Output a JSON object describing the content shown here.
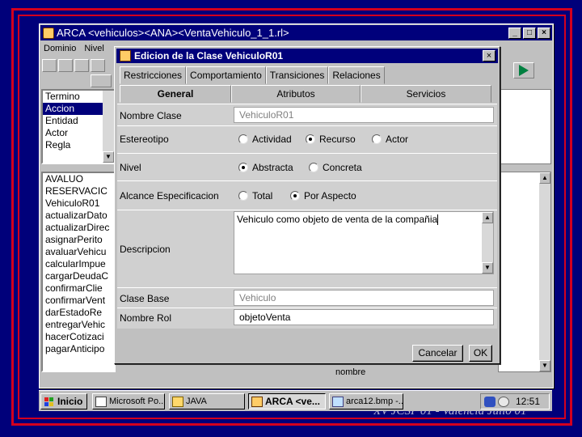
{
  "slide": {
    "footer": "XV JCSI '01 - Valencia Julio 01"
  },
  "main_window": {
    "title": "ARCA <vehiculos><ANA><VentaVehiculo_1_1.rl>",
    "menu": [
      "Dominio",
      "Nivel"
    ],
    "element_types": [
      "Termino",
      "Accion",
      "Entidad",
      "Actor",
      "Regla"
    ],
    "selected_type": "Accion",
    "elements": [
      "AVALUO",
      "RESERVACIC",
      "VehiculoR01",
      "actualizarDato",
      "actualizarDirec",
      "asignarPerito",
      "avaluarVehicu",
      "calcularImpue",
      "cargarDeudaC",
      "confirmarClie",
      "confirmarVent",
      "darEstadoRe",
      "entregarVehic",
      "hacerCotizaci",
      "pagarAnticipo"
    ],
    "bottom_label": "nombre"
  },
  "dialog": {
    "title": "Edicion de la Clase VehiculoR01",
    "tabs": [
      "Restricciones",
      "Comportamiento",
      "Transiciones",
      "Relaciones"
    ],
    "subtabs": [
      "General",
      "Atributos",
      "Servicios"
    ],
    "active_subtab": "General",
    "fields": {
      "nombre_clase": {
        "label": "Nombre Clase",
        "value": "VehiculoR01"
      },
      "estereotipo": {
        "label": "Estereotipo",
        "options": [
          "Actividad",
          "Recurso",
          "Actor"
        ],
        "selected": "Recurso"
      },
      "nivel": {
        "label": "Nivel",
        "options": [
          "Abstracta",
          "Concreta"
        ],
        "selected": "Abstracta"
      },
      "alcance": {
        "label": "Alcance Especificacion",
        "options": [
          "Total",
          "Por Aspecto"
        ],
        "selected": "Por Aspecto"
      },
      "descripcion": {
        "label": "Descripcion",
        "value": "Vehiculo como objeto de venta de la compañia"
      },
      "clase_base": {
        "label": "Clase Base",
        "value": "Vehiculo"
      },
      "nombre_rol": {
        "label": "Nombre Rol",
        "value": "objetoVenta"
      }
    },
    "buttons": {
      "cancel": "Cancelar",
      "ok": "OK"
    }
  },
  "taskbar": {
    "start": "Inicio",
    "items": [
      "Microsoft Po...",
      "JAVA",
      "ARCA <ve...",
      "arca12.bmp -..."
    ],
    "active_item": "ARCA <ve...",
    "clock": "12:51"
  },
  "colors": {
    "slide_bg": "#00007a",
    "frame": "#d4001e",
    "titlebar": "#00007b",
    "window": "#c0c0c0"
  }
}
